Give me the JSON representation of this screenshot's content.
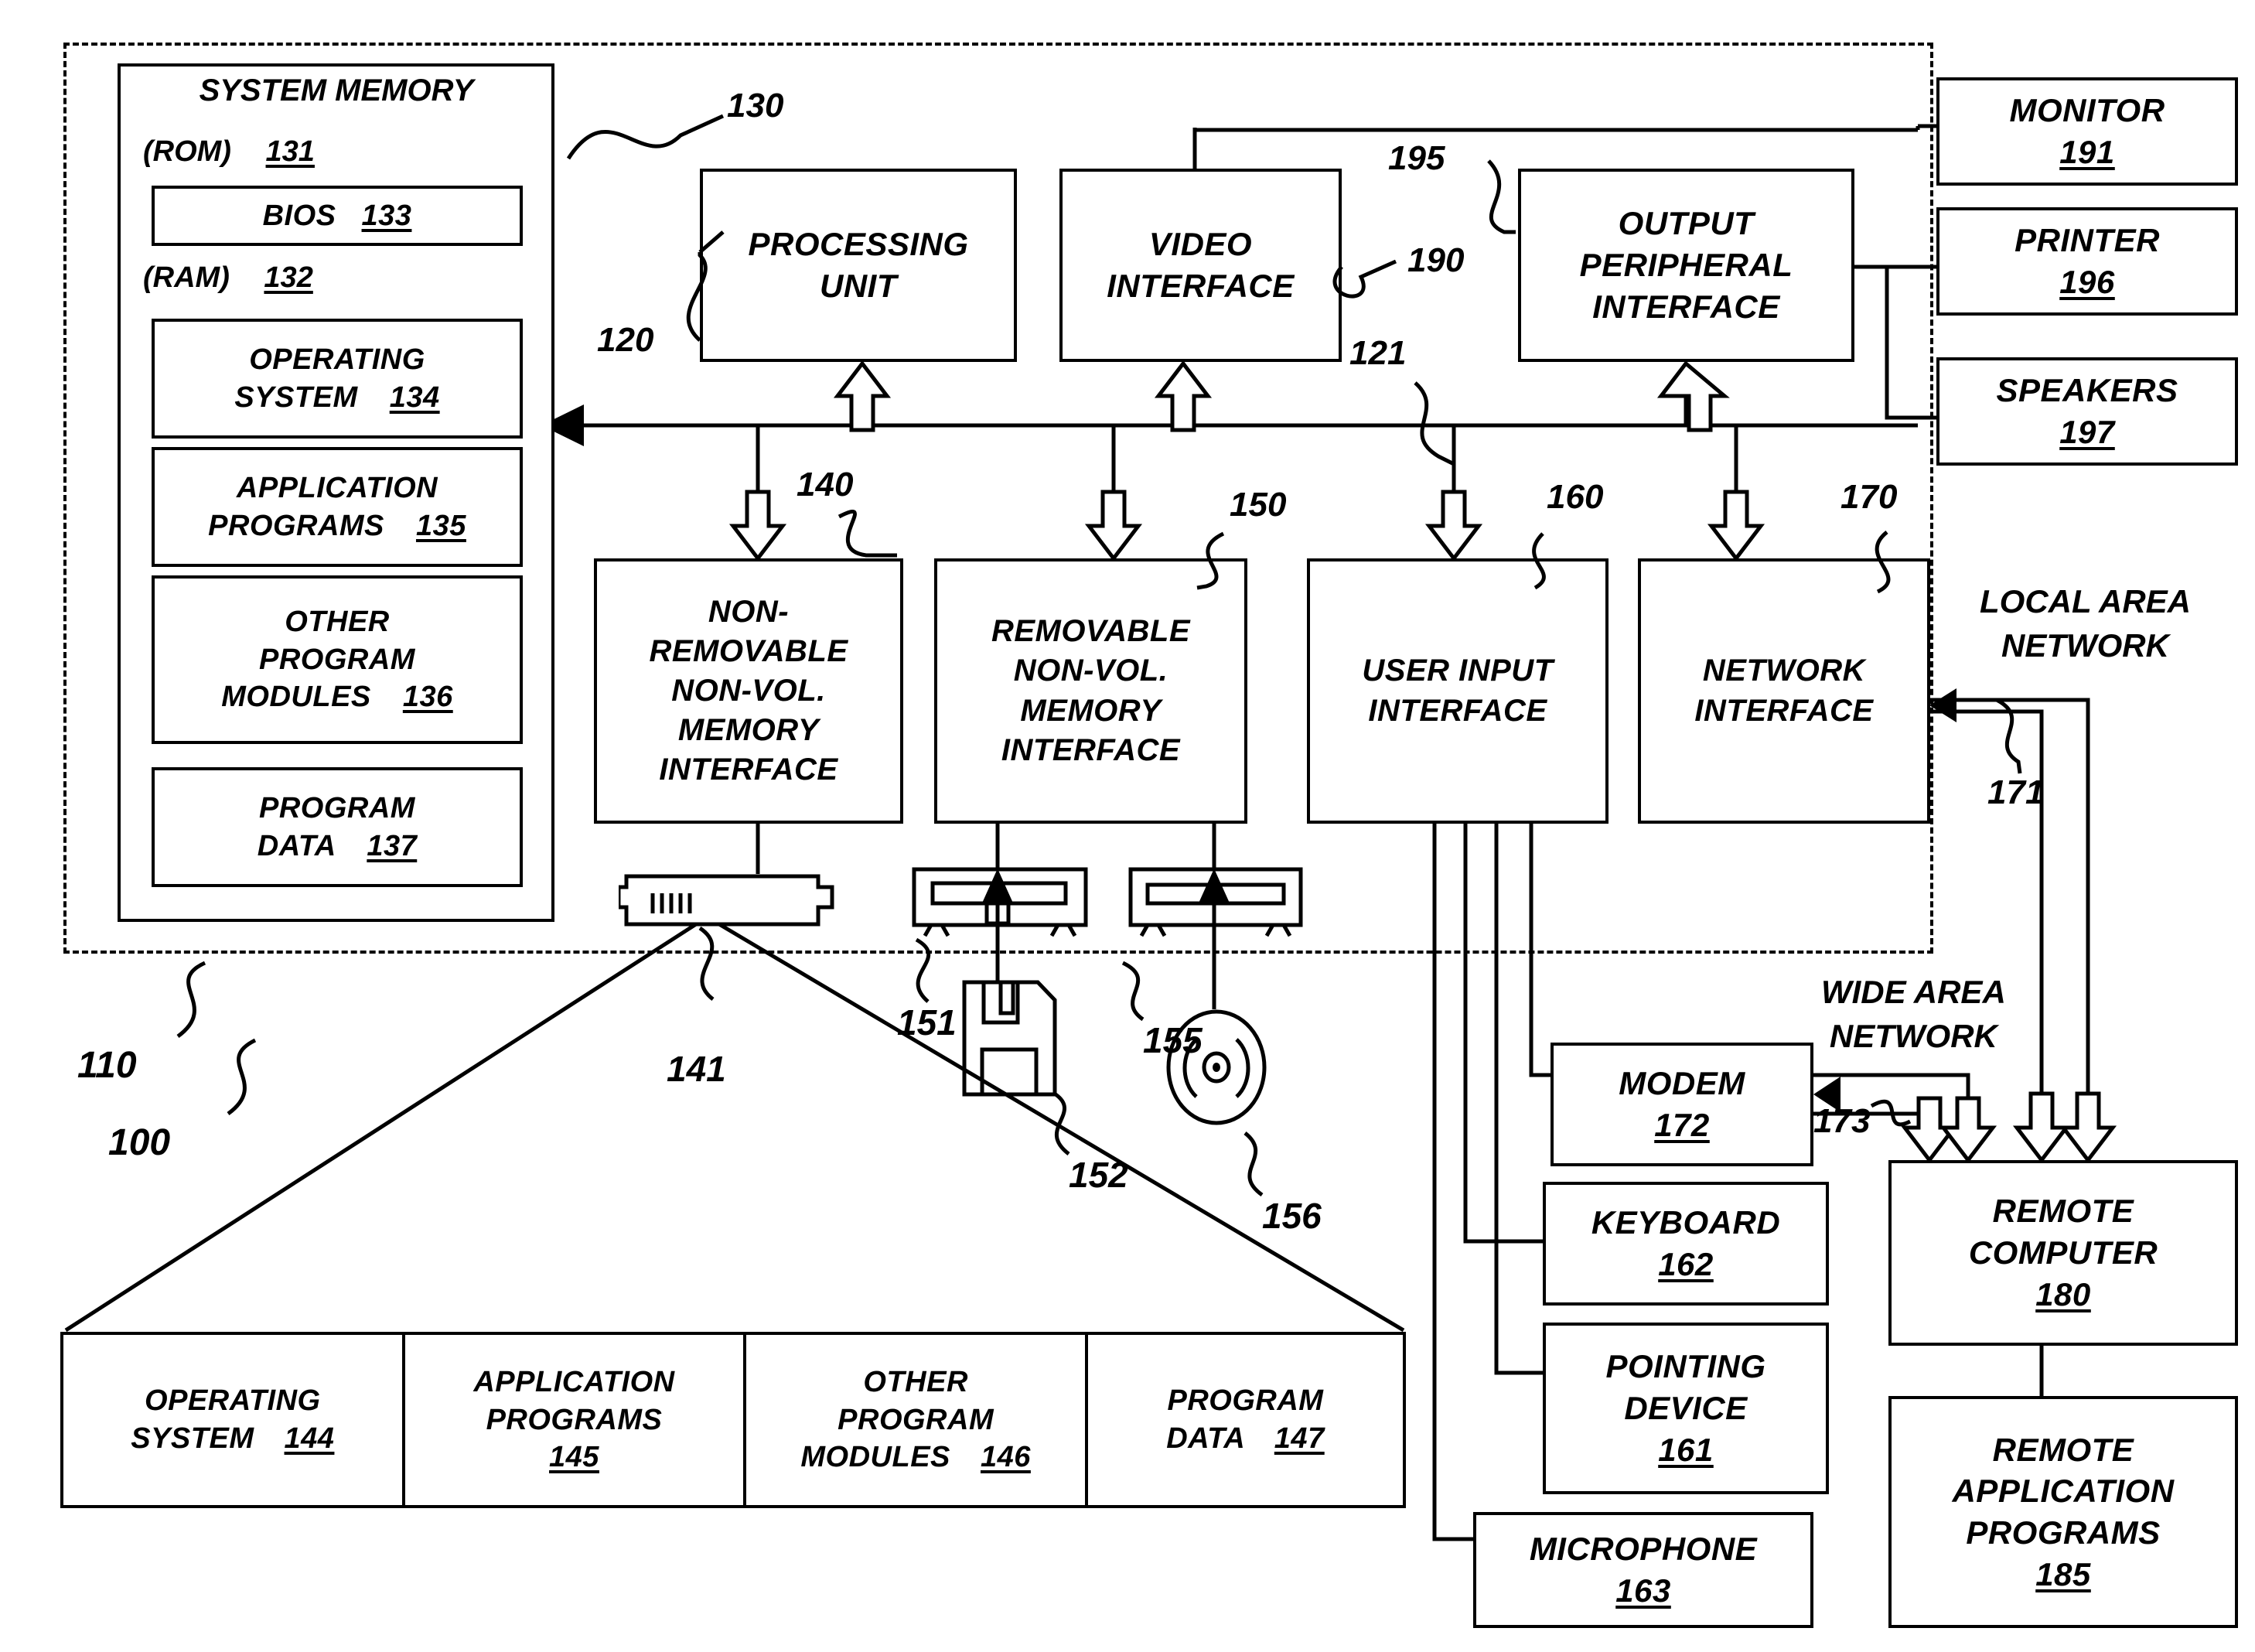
{
  "figure": {
    "type": "patent-block-diagram",
    "subject": "exemplary computing system environment",
    "reference_numerals": {
      "computing_environment": "100",
      "computer": "110",
      "processing_unit": "120",
      "system_bus": "121",
      "system_memory": "130",
      "rom": "131",
      "ram": "132",
      "bios": "133",
      "operating_system_ram": "134",
      "application_programs_ram": "135",
      "other_program_modules_ram": "136",
      "program_data_ram": "137",
      "non_removable_interface": "140",
      "hard_disk_drive": "141",
      "operating_system_disk": "144",
      "application_programs_disk": "145",
      "other_program_modules_disk": "146",
      "program_data_disk": "147",
      "removable_interface": "150",
      "floppy_drive": "151",
      "floppy_disk": "152",
      "optical_drive": "155",
      "optical_disk": "156",
      "user_input_interface": "160",
      "pointing_device": "161",
      "keyboard": "162",
      "microphone": "163",
      "network_interface": "170",
      "local_area_network": "171",
      "modem": "172",
      "wide_area_network": "173",
      "remote_computer": "180",
      "remote_application_programs": "185",
      "video_interface": "190",
      "monitor": "191",
      "output_peripheral_interface": "195",
      "printer": "196",
      "speakers": "197"
    }
  },
  "system_memory": {
    "title": "SYSTEM MEMORY",
    "ref": "130",
    "rom": {
      "label": "(ROM)",
      "ref": "131"
    },
    "bios": {
      "label": "BIOS",
      "ref": "133"
    },
    "ram": {
      "label": "(RAM)",
      "ref": "132"
    },
    "ram_blocks": [
      {
        "lines": [
          "OPERATING",
          "SYSTEM"
        ],
        "ref": "134"
      },
      {
        "lines": [
          "APPLICATION",
          "PROGRAMS"
        ],
        "ref": "135"
      },
      {
        "lines": [
          "OTHER",
          "PROGRAM",
          "MODULES"
        ],
        "ref": "136"
      },
      {
        "lines": [
          "PROGRAM",
          "DATA"
        ],
        "ref": "137"
      }
    ]
  },
  "core": {
    "processing_unit": {
      "lines": [
        "PROCESSING",
        "UNIT"
      ],
      "ref": "120"
    },
    "video_interface": {
      "lines": [
        "VIDEO",
        "INTERFACE"
      ],
      "ref": "190"
    },
    "output_peripheral_interface": {
      "lines": [
        "OUTPUT",
        "PERIPHERAL",
        "INTERFACE"
      ],
      "ref": "195"
    },
    "system_bus_ref": "121"
  },
  "interfaces": [
    {
      "lines": [
        "NON-",
        "REMOVABLE",
        "NON-VOL.",
        "MEMORY",
        "INTERFACE"
      ],
      "ref": "140"
    },
    {
      "lines": [
        "REMOVABLE",
        "NON-VOL.",
        "MEMORY",
        "INTERFACE"
      ],
      "ref": "150"
    },
    {
      "lines": [
        "USER INPUT",
        "INTERFACE"
      ],
      "ref": "160"
    },
    {
      "lines": [
        "NETWORK",
        "INTERFACE"
      ],
      "ref": "170"
    }
  ],
  "output_devices": [
    {
      "label": "MONITOR",
      "ref": "191"
    },
    {
      "label": "PRINTER",
      "ref": "196"
    },
    {
      "label": "SPEAKERS",
      "ref": "197"
    }
  ],
  "input_devices": [
    {
      "label": "MODEM",
      "ref": "172"
    },
    {
      "label": "KEYBOARD",
      "ref": "162"
    },
    {
      "lines": [
        "POINTING",
        "DEVICE"
      ],
      "ref": "161"
    },
    {
      "label": "MICROPHONE",
      "ref": "163"
    }
  ],
  "remote": {
    "computer": {
      "lines": [
        "REMOTE",
        "COMPUTER"
      ],
      "ref": "180"
    },
    "application_programs": {
      "lines": [
        "REMOTE",
        "APPLICATION",
        "PROGRAMS"
      ],
      "ref": "185"
    }
  },
  "network_labels": {
    "lan": {
      "lines": [
        "LOCAL AREA",
        "NETWORK"
      ],
      "ref": "171"
    },
    "wan": {
      "lines": [
        "WIDE AREA",
        "NETWORK"
      ],
      "ref": "173"
    }
  },
  "disk_contents": [
    {
      "lines": [
        "OPERATING",
        "SYSTEM"
      ],
      "ref": "144"
    },
    {
      "lines": [
        "APPLICATION",
        "PROGRAMS"
      ],
      "ref": "145"
    },
    {
      "lines": [
        "OTHER",
        "PROGRAM",
        "MODULES"
      ],
      "ref": "146"
    },
    {
      "lines": [
        "PROGRAM",
        "DATA"
      ],
      "ref": "147"
    }
  ],
  "media_refs": {
    "hard_disk_drive": "141",
    "floppy_drive": "151",
    "floppy_disk": "152",
    "optical_drive": "155",
    "optical_disk": "156"
  },
  "outer_refs": {
    "computer": "110",
    "environment": "100"
  }
}
